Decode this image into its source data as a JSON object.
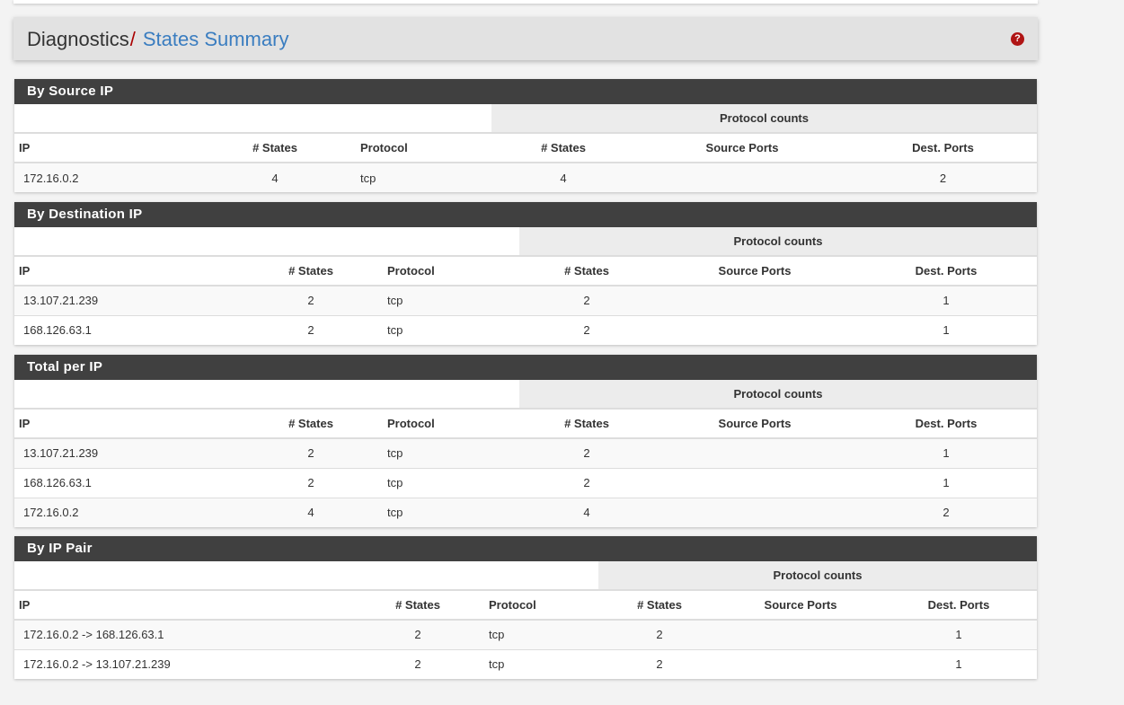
{
  "breadcrumb": {
    "parent": "Diagnostics",
    "separator": "/",
    "current": "States Summary"
  },
  "help_icon": "?",
  "column_headers": {
    "group": "Protocol counts",
    "ip": "IP",
    "states": "# States",
    "protocol": "Protocol",
    "proto_states": "# States",
    "source_ports": "Source Ports",
    "dest_ports": "Dest. Ports"
  },
  "sections": [
    {
      "title": "By Source IP",
      "rows": [
        {
          "ip": "172.16.0.2",
          "states": "4",
          "protocol": "tcp",
          "proto_states": "4",
          "source_ports": "",
          "dest_ports": "2"
        }
      ]
    },
    {
      "title": "By Destination IP",
      "rows": [
        {
          "ip": "13.107.21.239",
          "states": "2",
          "protocol": "tcp",
          "proto_states": "2",
          "source_ports": "",
          "dest_ports": "1"
        },
        {
          "ip": "168.126.63.1",
          "states": "2",
          "protocol": "tcp",
          "proto_states": "2",
          "source_ports": "",
          "dest_ports": "1"
        }
      ]
    },
    {
      "title": "Total per IP",
      "rows": [
        {
          "ip": "13.107.21.239",
          "states": "2",
          "protocol": "tcp",
          "proto_states": "2",
          "source_ports": "",
          "dest_ports": "1"
        },
        {
          "ip": "168.126.63.1",
          "states": "2",
          "protocol": "tcp",
          "proto_states": "2",
          "source_ports": "",
          "dest_ports": "1"
        },
        {
          "ip": "172.16.0.2",
          "states": "4",
          "protocol": "tcp",
          "proto_states": "4",
          "source_ports": "",
          "dest_ports": "2"
        }
      ]
    },
    {
      "title": "By IP Pair",
      "rows": [
        {
          "ip": "172.16.0.2 -> 168.126.63.1",
          "states": "2",
          "protocol": "tcp",
          "proto_states": "2",
          "source_ports": "",
          "dest_ports": "1"
        },
        {
          "ip": "172.16.0.2 -> 13.107.21.239",
          "states": "2",
          "protocol": "tcp",
          "proto_states": "2",
          "source_ports": "",
          "dest_ports": "1"
        }
      ]
    }
  ],
  "colors": {
    "panel_heading": "#404040",
    "breadcrumb_link": "#3a7dc0",
    "breadcrumb_separator": "#aa0000",
    "help_icon": "#b01515"
  }
}
